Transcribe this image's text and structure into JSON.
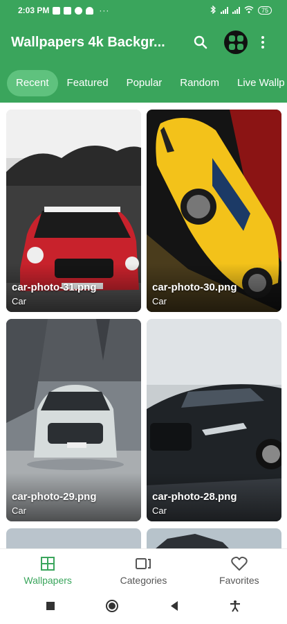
{
  "status_bar": {
    "time": "2:03 PM",
    "dots": "···",
    "battery": "75"
  },
  "app_bar": {
    "title": "Wallpapers 4k Backgr..."
  },
  "tabs": [
    {
      "label": "Recent",
      "active": true
    },
    {
      "label": "Featured"
    },
    {
      "label": "Popular"
    },
    {
      "label": "Random"
    },
    {
      "label": "Live Wallp"
    }
  ],
  "wallpapers": [
    {
      "file": "car-photo-31.png",
      "category": "Car"
    },
    {
      "file": "car-photo-30.png",
      "category": "Car"
    },
    {
      "file": "car-photo-29.png",
      "category": "Car"
    },
    {
      "file": "car-photo-28.png",
      "category": "Car"
    }
  ],
  "bottom_nav": [
    {
      "label": "Wallpapers",
      "icon": "grid-icon",
      "active": true
    },
    {
      "label": "Categories",
      "icon": "categories-icon"
    },
    {
      "label": "Favorites",
      "icon": "heart-icon"
    }
  ],
  "colors": {
    "primary": "#3aa55c",
    "tab_active": "#5fc27e"
  }
}
